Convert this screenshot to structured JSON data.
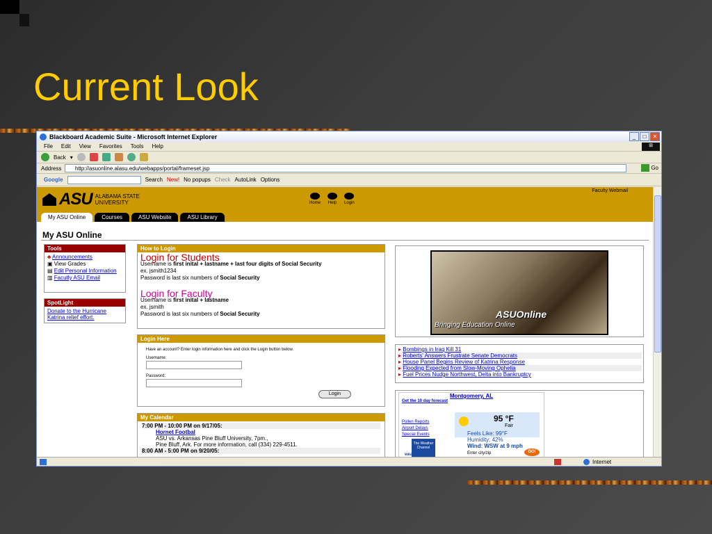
{
  "slide": {
    "title": "Current Look"
  },
  "window": {
    "title": "Blackboard Academic Suite - Microsoft Internet Explorer",
    "menu": [
      "File",
      "Edit",
      "View",
      "Favorites",
      "Tools",
      "Help"
    ],
    "toolbar": {
      "back_label": "Back"
    },
    "address": {
      "label": "Address",
      "url": "http://asuonline.alasu.edu/webapps/portal/frameset.jsp",
      "go_label": "Go"
    },
    "google": {
      "label": "Google",
      "search_label": "Search",
      "new_label": "New!",
      "popups_label": "No popups",
      "check_label": "Check",
      "autolink_label": "AutoLink",
      "options_label": "Options"
    },
    "status": {
      "zone": "Internet"
    }
  },
  "portal": {
    "logo_text": "ASU",
    "university_line1": "ALABAMA STATE",
    "university_line2": "UNIVERSITY",
    "faculty_webmail": "Faculty Webmail",
    "header_icons": [
      "Home",
      "Help",
      "Login"
    ],
    "tabs": [
      "My ASU Online",
      "Courses",
      "ASU Website",
      "ASU Library"
    ],
    "page_title": "My ASU Online",
    "tools": {
      "header": "Tools",
      "items": [
        "Announcements",
        "View Grades",
        "Edit Personal Information",
        "Facutly ASU Email"
      ]
    },
    "spotlight": {
      "header": "SpotLight",
      "link": "Donate to the Hurricane Katrina relief effort."
    },
    "how_to_login": {
      "header": "How to Login",
      "students_title": "Login for Students",
      "students_line1_pre": "Username is ",
      "students_line1_bold": "first inital + lastname + last four digits of Social Security",
      "students_line2": "ex. jsmith1234",
      "students_line3_pre": "Password is last six numbers of ",
      "students_line3_bold": "Social Security",
      "faculty_title": "Login for Faculty",
      "faculty_line1_pre": "Username is ",
      "faculty_line1_bold": "first inital + lastname",
      "faculty_line2": "ex. jsmith",
      "faculty_line3_pre": "Password is last six numbers of ",
      "faculty_line3_bold": "Social Security"
    },
    "login_here": {
      "header": "Login Here",
      "intro": "Have an account? Enter login information here and click the Login button below.",
      "username_label": "Username:",
      "password_label": "Password:",
      "button": "Login"
    },
    "calendar": {
      "header": "My Calendar",
      "time1": "7:00 PM - 10:00 PM on 9/17/05:",
      "event1_title": "Hornet Footbal",
      "event1_line1": "ASU vs. Arkansas Pine Bluff University, 7pm.,",
      "event1_line2": "Pine Bluff, Ark. For more information, call (334) 229-4511.",
      "time2": "8:00 AM - 5:00 PM on 9/20/05:"
    },
    "asuonline": {
      "brand": "ASUOnline",
      "tagline": "Bringing Education Online"
    },
    "news": [
      "Bombings in Iraq Kill 31",
      "Roberts' Answers Frustrate Senate Democrats",
      "House Panel Begins Review of Katrina Response",
      "Flooding Expected from Slow-Moving Ophelia",
      "Fuel Prices Nudge Northwest, Delta into Bankruptcy"
    ],
    "weather": {
      "city": "Montgomery, AL",
      "forecast_link": "Get the 10 day forecast",
      "side_links": [
        "Pollen Reports",
        "Airport Delays",
        "Special Events"
      ],
      "temp": "95 °F",
      "cond": "Fair",
      "feels": "Feels Like: 99°F",
      "humidity": "Humidity: 42%",
      "wind": "Wind: WSW at 9 mph",
      "enter": "Enter city/zip",
      "go": "GO!",
      "twc_text": "The Weather Channel",
      "site": "weather.com"
    }
  }
}
